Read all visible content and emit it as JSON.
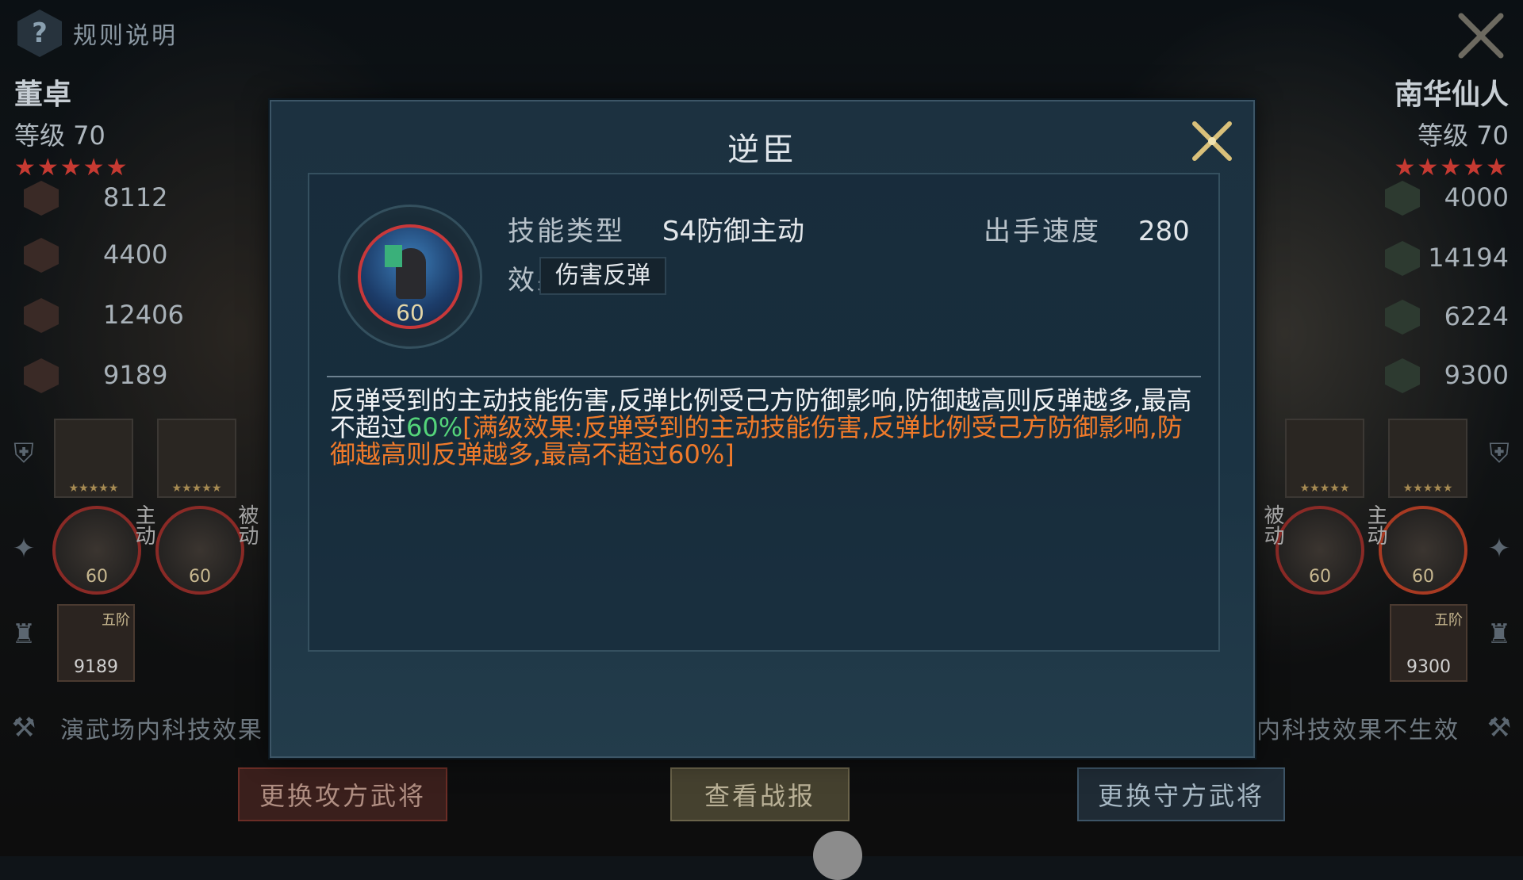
{
  "topbar": {
    "rules_label": "规则说明",
    "rules_icon": "?"
  },
  "attacker": {
    "name": "董卓",
    "level": "等级 70",
    "stars": "★★★★★",
    "stats": [
      "8112",
      "4400",
      "12406",
      "9189"
    ],
    "skills": [
      {
        "level": "60",
        "type": "主动"
      },
      {
        "level": "60",
        "type": "被动"
      }
    ],
    "soldier": {
      "tier": "五阶",
      "count": "9189"
    },
    "tech_note": "演武场内科技效果"
  },
  "defender": {
    "name": "南华仙人",
    "level": "等级 70",
    "stars": "★★★★★",
    "stats": [
      "4000",
      "14194",
      "6224",
      "9300"
    ],
    "skills": [
      {
        "level": "60",
        "type": "被动"
      },
      {
        "level": "60",
        "type": "主动"
      }
    ],
    "soldier": {
      "tier": "五阶",
      "count": "9300"
    },
    "tech_note": "内科技效果不生效"
  },
  "buttons": {
    "change_attacker": "更换攻方武将",
    "view_report": "查看战报",
    "change_defender": "更换守方武将"
  },
  "modal": {
    "title": "逆臣",
    "skill_level": "60",
    "type_label": "技能类型",
    "type_value": "S4防御主动",
    "speed_label": "出手速度",
    "speed_value": "280",
    "effect_label": "效果",
    "effect_value": "伤害反弹",
    "desc_main": "反弹受到的主动技能伤害,反弹比例受己方防御影响,防御越高则反弹越多,最高不超过",
    "desc_green": "60%",
    "desc_orange": "[满级效果:反弹受到的主动技能伤害,反弹比例受己方防御影响,防御越高则反弹越多,最高不超过60%]"
  },
  "colors": {
    "accent_gold": "#d9c07a",
    "highlight_green": "#54d47a",
    "highlight_orange": "#f07a2a",
    "ring_red": "#c8383a"
  }
}
